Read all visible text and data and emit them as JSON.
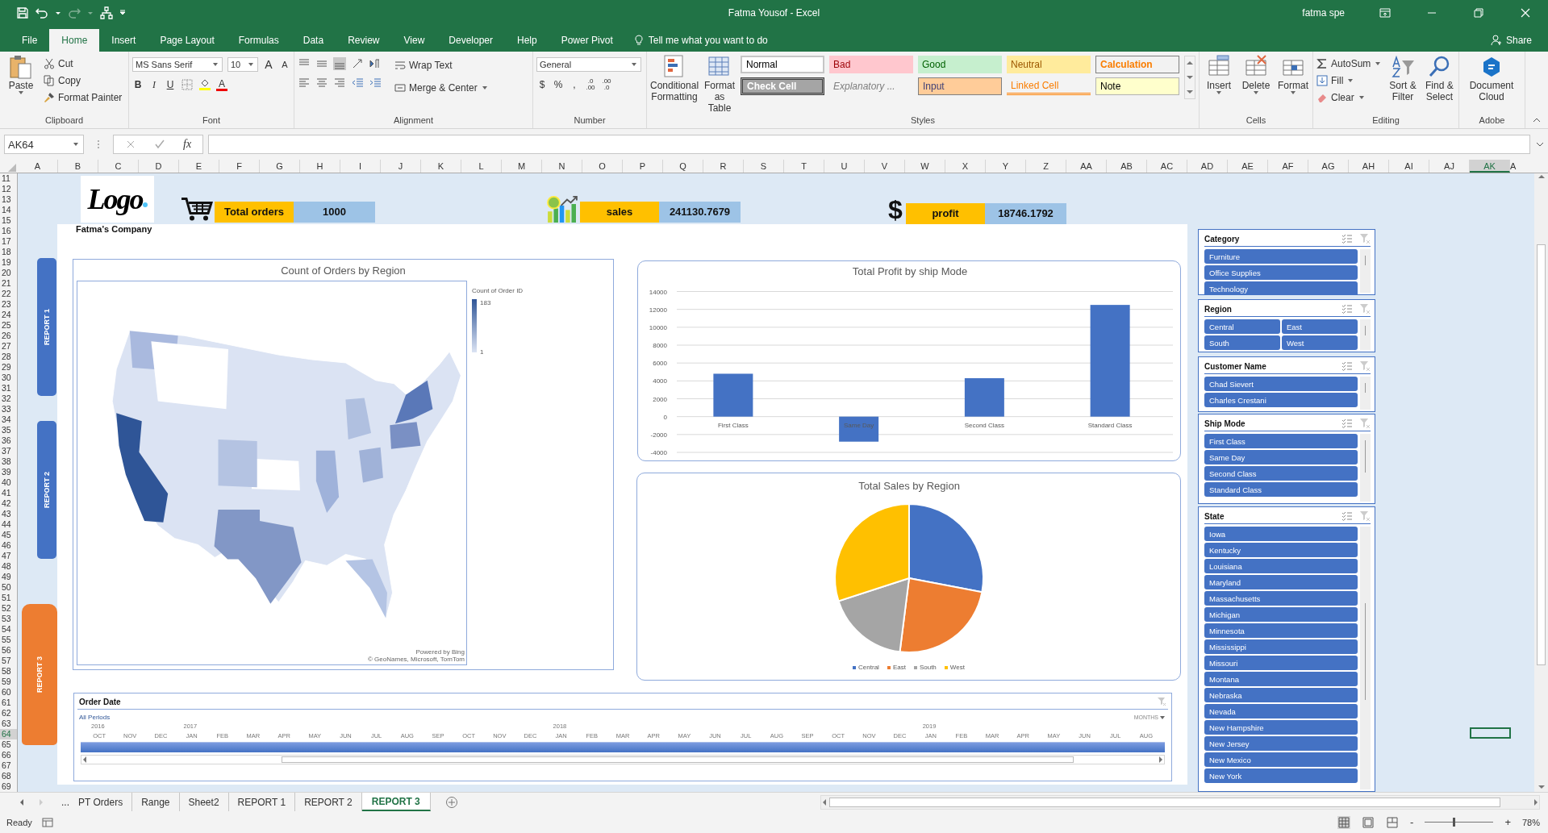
{
  "title_bar": {
    "title": "Fatma Yousof  -  Excel",
    "user": "fatma spe"
  },
  "menu_tabs": [
    {
      "label": "File",
      "selected": false
    },
    {
      "label": "Home",
      "selected": true
    },
    {
      "label": "Insert",
      "selected": false
    },
    {
      "label": "Page Layout",
      "selected": false
    },
    {
      "label": "Formulas",
      "selected": false
    },
    {
      "label": "Data",
      "selected": false
    },
    {
      "label": "Review",
      "selected": false
    },
    {
      "label": "View",
      "selected": false
    },
    {
      "label": "Developer",
      "selected": false
    },
    {
      "label": "Help",
      "selected": false
    },
    {
      "label": "Power Pivot",
      "selected": false
    }
  ],
  "tell_me": "Tell me what you want to do",
  "share": "Share",
  "ribbon": {
    "clipboard": {
      "label": "Clipboard",
      "paste": "Paste",
      "cut": "Cut",
      "copy": "Copy",
      "format_painter": "Format Painter"
    },
    "font": {
      "label": "Font",
      "family": "MS Sans Serif",
      "size": "10",
      "grow": "A",
      "shrink": "A",
      "bold": "B",
      "italic": "I",
      "underline": "U",
      "font_color": "A"
    },
    "alignment": {
      "label": "Alignment",
      "wrap_text": "Wrap Text",
      "merge_center": "Merge & Center"
    },
    "number": {
      "label": "Number",
      "format": "General",
      "currency": "$",
      "percent": "%",
      "comma": ",",
      "increase_decimal": [
        ".0",
        ".00"
      ],
      "decrease_decimal": [
        ".00",
        ".0"
      ]
    },
    "styles": {
      "label": "Styles",
      "conditional_formatting": "Conditional Formatting",
      "format_as_table": "Format as Table",
      "cell_styles": [
        {
          "label": "Normal",
          "kind": "normal"
        },
        {
          "label": "Bad",
          "kind": "bad"
        },
        {
          "label": "Good",
          "kind": "good"
        },
        {
          "label": "Neutral",
          "kind": "neutral"
        },
        {
          "label": "Calculation",
          "kind": "calculation"
        },
        {
          "label": "Check Cell",
          "kind": "check"
        },
        {
          "label": "Explanatory ...",
          "kind": "explanatory"
        },
        {
          "label": "Input",
          "kind": "input"
        },
        {
          "label": "Linked Cell",
          "kind": "linked"
        },
        {
          "label": "Note",
          "kind": "note"
        }
      ]
    },
    "cells": {
      "label": "Cells",
      "buttons": [
        "Insert",
        "Delete",
        "Format"
      ]
    },
    "editing": {
      "label": "Editing",
      "autosum": "AutoSum",
      "fill": "Fill",
      "clear": "Clear",
      "sort_filter": "Sort & Filter",
      "find_select": "Find & Select"
    },
    "adobe": {
      "label": "Adobe",
      "document_cloud": "Document Cloud"
    }
  },
  "formula_bar": {
    "name_box": "AK64",
    "fx": "fx"
  },
  "columns": [
    {
      "label": "A",
      "selected": false
    },
    {
      "label": "B",
      "selected": false
    },
    {
      "label": "C",
      "selected": false
    },
    {
      "label": "D",
      "selected": false
    },
    {
      "label": "E",
      "selected": false
    },
    {
      "label": "F",
      "selected": false
    },
    {
      "label": "G",
      "selected": false
    },
    {
      "label": "H",
      "selected": false
    },
    {
      "label": "I",
      "selected": false
    },
    {
      "label": "J",
      "selected": false
    },
    {
      "label": "K",
      "selected": false
    },
    {
      "label": "L",
      "selected": false
    },
    {
      "label": "M",
      "selected": false
    },
    {
      "label": "N",
      "selected": false
    },
    {
      "label": "O",
      "selected": false
    },
    {
      "label": "P",
      "selected": false
    },
    {
      "label": "Q",
      "selected": false
    },
    {
      "label": "R",
      "selected": false
    },
    {
      "label": "S",
      "selected": false
    },
    {
      "label": "T",
      "selected": false
    },
    {
      "label": "U",
      "selected": false
    },
    {
      "label": "V",
      "selected": false
    },
    {
      "label": "W",
      "selected": false
    },
    {
      "label": "X",
      "selected": false
    },
    {
      "label": "Y",
      "selected": false
    },
    {
      "label": "Z",
      "selected": false
    },
    {
      "label": "AA",
      "selected": false
    },
    {
      "label": "AB",
      "selected": false
    },
    {
      "label": "AC",
      "selected": false
    },
    {
      "label": "AD",
      "selected": false
    },
    {
      "label": "AE",
      "selected": false
    },
    {
      "label": "AF",
      "selected": false
    },
    {
      "label": "AG",
      "selected": false
    },
    {
      "label": "AH",
      "selected": false
    },
    {
      "label": "AI",
      "selected": false
    },
    {
      "label": "AJ",
      "selected": false
    },
    {
      "label": "AK",
      "selected": true
    },
    {
      "label": "A",
      "selected": false
    }
  ],
  "rows": [
    {
      "label": "11",
      "selected": false
    },
    {
      "label": "12",
      "selected": false
    },
    {
      "label": "13",
      "selected": false
    },
    {
      "label": "14",
      "selected": false
    },
    {
      "label": "15",
      "selected": false
    },
    {
      "label": "16",
      "selected": false
    },
    {
      "label": "17",
      "selected": false
    },
    {
      "label": "18",
      "selected": false
    },
    {
      "label": "19",
      "selected": false
    },
    {
      "label": "20",
      "selected": false
    },
    {
      "label": "21",
      "selected": false
    },
    {
      "label": "22",
      "selected": false
    },
    {
      "label": "23",
      "selected": false
    },
    {
      "label": "24",
      "selected": false
    },
    {
      "label": "25",
      "selected": false
    },
    {
      "label": "26",
      "selected": false
    },
    {
      "label": "27",
      "selected": false
    },
    {
      "label": "28",
      "selected": false
    },
    {
      "label": "29",
      "selected": false
    },
    {
      "label": "30",
      "selected": false
    },
    {
      "label": "31",
      "selected": false
    },
    {
      "label": "32",
      "selected": false
    },
    {
      "label": "33",
      "selected": false
    },
    {
      "label": "34",
      "selected": false
    },
    {
      "label": "35",
      "selected": false
    },
    {
      "label": "36",
      "selected": false
    },
    {
      "label": "37",
      "selected": false
    },
    {
      "label": "38",
      "selected": false
    },
    {
      "label": "39",
      "selected": false
    },
    {
      "label": "40",
      "selected": false
    },
    {
      "label": "41",
      "selected": false
    },
    {
      "label": "42",
      "selected": false
    },
    {
      "label": "43",
      "selected": false
    },
    {
      "label": "44",
      "selected": false
    },
    {
      "label": "45",
      "selected": false
    },
    {
      "label": "46",
      "selected": false
    },
    {
      "label": "47",
      "selected": false
    },
    {
      "label": "48",
      "selected": false
    },
    {
      "label": "49",
      "selected": false
    },
    {
      "label": "50",
      "selected": false
    },
    {
      "label": "51",
      "selected": false
    },
    {
      "label": "52",
      "selected": false
    },
    {
      "label": "53",
      "selected": false
    },
    {
      "label": "54",
      "selected": false
    },
    {
      "label": "55",
      "selected": false
    },
    {
      "label": "56",
      "selected": false
    },
    {
      "label": "57",
      "selected": false
    },
    {
      "label": "58",
      "selected": false
    },
    {
      "label": "59",
      "selected": false
    },
    {
      "label": "60",
      "selected": false
    },
    {
      "label": "61",
      "selected": false
    },
    {
      "label": "62",
      "selected": false
    },
    {
      "label": "63",
      "selected": false
    },
    {
      "label": "64",
      "selected": true
    },
    {
      "label": "65",
      "selected": false
    },
    {
      "label": "66",
      "selected": false
    },
    {
      "label": "67",
      "selected": false
    },
    {
      "label": "68",
      "selected": false
    },
    {
      "label": "69",
      "selected": false
    }
  ],
  "header": {
    "logo": "Logo",
    "company": "Fatma's Company"
  },
  "kpis": [
    {
      "label": "Total orders",
      "value": "1000"
    },
    {
      "label": "sales",
      "value": "241130.7679"
    },
    {
      "label": "profit",
      "value": "18746.1792",
      "icon_text": "$"
    }
  ],
  "nav_buttons": [
    {
      "label": "REPORT 1",
      "selected": false
    },
    {
      "label": "REPORT 2",
      "selected": false
    },
    {
      "label": "REPORT 3",
      "selected": true
    }
  ],
  "map_chart": {
    "chart_title": "Count of Orders by Region",
    "legend_title": "Count of Order ID",
    "legend_max": "183",
    "legend_min": "1",
    "attribution": [
      "Powered by Bing",
      "© GeoNames, Microsoft, TomTom"
    ],
    "map": {
      "kind": "picture"
    }
  },
  "profit_chart": {
    "chart_data": {
      "type": "bar",
      "title": "Total Profit by ship Mode",
      "categories": [
        "First Class",
        "Same Day",
        "Second Class",
        "Standard Class"
      ],
      "series": [
        {
          "color": "#4472c4",
          "values": [
            4800,
            -2800,
            4300,
            12500
          ]
        }
      ],
      "grid": true,
      "ylim": [
        -4000,
        14000
      ],
      "yticks": [
        -4000,
        -2000,
        0,
        2000,
        4000,
        6000,
        8000,
        10000,
        12000,
        14000
      ]
    }
  },
  "sales_chart": {
    "chart_data": {
      "type": "pie",
      "title": "Total Sales by Region",
      "categories": [
        "Central",
        "East",
        "South",
        "West"
      ],
      "series": [
        {
          "values": [
            0.28,
            0.24,
            0.18,
            0.3
          ]
        }
      ],
      "legend": "bottom"
    }
  },
  "timeline": {
    "title": "Order Date",
    "filter_label": "All Periods",
    "level_label": "MONTHS",
    "years": [
      {
        "label": "2016",
        "months": [
          "OCT",
          "NOV",
          "DEC"
        ]
      },
      {
        "label": "2017",
        "months": [
          "JAN",
          "FEB",
          "MAR",
          "APR",
          "MAY",
          "JUN",
          "JUL",
          "AUG",
          "SEP",
          "OCT",
          "NOV",
          "DEC"
        ]
      },
      {
        "label": "2018",
        "months": [
          "JAN",
          "FEB",
          "MAR",
          "APR",
          "MAY",
          "JUN",
          "JUL",
          "AUG",
          "SEP",
          "OCT",
          "NOV",
          "DEC"
        ]
      },
      {
        "label": "2019",
        "months": [
          "JAN",
          "FEB",
          "MAR",
          "APR",
          "MAY",
          "JUN",
          "JUL",
          "AUG"
        ]
      }
    ]
  },
  "slicers": [
    {
      "title": "Category",
      "kind": "list",
      "items": [
        {
          "label": "Furniture",
          "selected": true
        },
        {
          "label": "Office Supplies",
          "selected": true
        },
        {
          "label": "Technology",
          "selected": true
        }
      ]
    },
    {
      "title": "Region",
      "kind": "grid",
      "items": [
        {
          "label": "Central",
          "selected": true
        },
        {
          "label": "East",
          "selected": true
        },
        {
          "label": "South",
          "selected": true
        },
        {
          "label": "West",
          "selected": true
        }
      ]
    },
    {
      "title": "Customer Name",
      "kind": "list",
      "items": [
        {
          "label": "Chad Sievert",
          "selected": true
        },
        {
          "label": "Charles Crestani",
          "selected": true
        }
      ]
    },
    {
      "title": "Ship Mode",
      "kind": "list",
      "items": [
        {
          "label": "First Class",
          "selected": true
        },
        {
          "label": "Same Day",
          "selected": true
        },
        {
          "label": "Second Class",
          "selected": true
        },
        {
          "label": "Standard Class",
          "selected": true
        }
      ]
    },
    {
      "title": "State",
      "kind": "list",
      "items": [
        {
          "label": "Iowa",
          "selected": true
        },
        {
          "label": "Kentucky",
          "selected": true
        },
        {
          "label": "Louisiana",
          "selected": true
        },
        {
          "label": "Maryland",
          "selected": true
        },
        {
          "label": "Massachusetts",
          "selected": true
        },
        {
          "label": "Michigan",
          "selected": true
        },
        {
          "label": "Minnesota",
          "selected": true
        },
        {
          "label": "Mississippi",
          "selected": true
        },
        {
          "label": "Missouri",
          "selected": true
        },
        {
          "label": "Montana",
          "selected": true
        },
        {
          "label": "Nebraska",
          "selected": true
        },
        {
          "label": "Nevada",
          "selected": true
        },
        {
          "label": "New Hampshire",
          "selected": true
        },
        {
          "label": "New Jersey",
          "selected": true
        },
        {
          "label": "New Mexico",
          "selected": true
        },
        {
          "label": "New York",
          "selected": true
        }
      ]
    }
  ],
  "sheet_tabs": {
    "more": "...",
    "tabs": [
      {
        "label": "PT Orders",
        "selected": false
      },
      {
        "label": "Range",
        "selected": false
      },
      {
        "label": "Sheet2",
        "selected": false
      },
      {
        "label": "REPORT 1",
        "selected": false
      },
      {
        "label": "REPORT 2",
        "selected": false
      },
      {
        "label": "REPORT 3",
        "selected": true
      }
    ]
  },
  "status_bar": {
    "ready": "Ready",
    "zoom": {
      "minus": "-",
      "plus": "+",
      "reading": "78%",
      "level": 0.41
    }
  }
}
